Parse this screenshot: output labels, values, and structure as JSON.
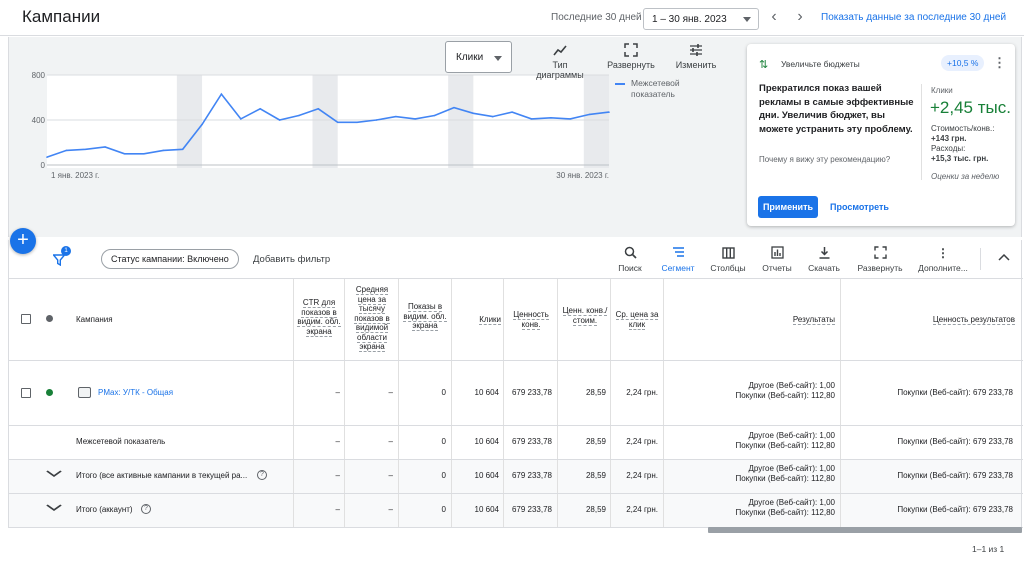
{
  "header": {
    "title": "Кампании",
    "range_label": "Последние 30 дней",
    "date_range": "1 – 30 янв. 2023",
    "prev": "‹",
    "next": "›",
    "show_link": "Показать данные за последние 30 дней"
  },
  "chart_panel": {
    "metric": "Клики",
    "tools": [
      {
        "icon": "trend-icon",
        "label": "Тип диаграммы"
      },
      {
        "icon": "fullscreen-icon",
        "label": "Развернуть"
      },
      {
        "icon": "tune-icon",
        "label": "Изменить"
      }
    ],
    "legend": "Межсетевой показатель"
  },
  "chart_data": {
    "type": "line",
    "x_tick_labels": [
      "1 янв. 2023 г.",
      "30 янв. 2023 г."
    ],
    "y_ticks": [
      0,
      400,
      800
    ],
    "ylim": [
      0,
      800
    ],
    "grid": true,
    "legend_position": "top-right",
    "series": [
      {
        "name": "Межсетевой показатель",
        "color": "#4285f4",
        "values": [
          70,
          130,
          140,
          160,
          100,
          100,
          130,
          140,
          360,
          630,
          410,
          500,
          400,
          440,
          500,
          380,
          380,
          400,
          430,
          410,
          440,
          510,
          460,
          430,
          470,
          410,
          420,
          410,
          450,
          470
        ]
      }
    ]
  },
  "recommendation": {
    "title": "Увеличьте бюджеты",
    "badge": "+10,5 %",
    "text": "Прекратился показ вашей рекламы в самые эффективные дни. Увеличив бюджет, вы можете устранить эту проблему.",
    "why": "Почему я вижу эту рекомендацию?",
    "metric_label": "Клики",
    "metric_value": "+2,45 тыс.",
    "cost_label": "Стоимость/конв.:",
    "cost_value": "+143 грн.",
    "spend_label": "Расходы:",
    "spend_value": "+15,3 тыс. грн.",
    "estimate": "Оценки за неделю",
    "apply": "Применить",
    "view": "Просмотреть"
  },
  "toolbar": {
    "filter_count": "1",
    "status_chip": "Статус кампании: Включено",
    "add_filter": "Добавить фильтр",
    "tools": [
      {
        "icon": "search-icon",
        "label": "Поиск"
      },
      {
        "icon": "segment-icon",
        "label": "Сегмент"
      },
      {
        "icon": "columns-icon",
        "label": "Столбцы"
      },
      {
        "icon": "reports-icon",
        "label": "Отчеты"
      },
      {
        "icon": "download-icon",
        "label": "Скачать"
      },
      {
        "icon": "fullscreen-icon",
        "label": "Развернуть"
      },
      {
        "icon": "more-icon",
        "label": "Дополните..."
      }
    ]
  },
  "table": {
    "headers": {
      "campaign": "Кампания",
      "ctr": "CTR для показов в видим. обл. экрана",
      "cpm": "Средняя цена за тысячу показов в видимой области экрана",
      "impressions": "Показы в видим. обл. экрана",
      "clicks": "Клики",
      "conv_value": "Ценность конв.",
      "value_cost": "Ценн. конв./стоим.",
      "avg_cpc": "Ср. цена за клик",
      "results": "Результаты",
      "results_value": "Ценность результатов"
    },
    "rows": [
      {
        "name": "PMax: У/ТК - Общая",
        "ctr": "–",
        "cpm": "–",
        "impressions": "0",
        "clicks": "10 604",
        "conv_value": "679 233,78",
        "value_cost": "28,59",
        "avg_cpc": "2,24 грн.",
        "results_1": "Другое (Веб-сайт): 1,00",
        "results_2": "Покупки (Веб-сайт): 112,80",
        "results_value": "Покупки (Веб-сайт): 679 233,78"
      },
      {
        "name": "Межсетевой показатель",
        "ctr": "–",
        "cpm": "–",
        "impressions": "0",
        "clicks": "10 604",
        "conv_value": "679 233,78",
        "value_cost": "28,59",
        "avg_cpc": "2,24 грн.",
        "results_1": "Другое (Веб-сайт): 1,00",
        "results_2": "Покупки (Веб-сайт): 112,80",
        "results_value": "Покупки (Веб-сайт): 679 233,78"
      },
      {
        "name": "Итого (все активные кампании в текущей ра...",
        "ctr": "–",
        "cpm": "–",
        "impressions": "0",
        "clicks": "10 604",
        "conv_value": "679 233,78",
        "value_cost": "28,59",
        "avg_cpc": "2,24 грн.",
        "results_1": "Другое (Веб-сайт): 1,00",
        "results_2": "Покупки (Веб-сайт): 112,80",
        "results_value": "Покупки (Веб-сайт): 679 233,78"
      },
      {
        "name": "Итого (аккаунт)",
        "ctr": "–",
        "cpm": "–",
        "impressions": "0",
        "clicks": "10 604",
        "conv_value": "679 233,78",
        "value_cost": "28,59",
        "avg_cpc": "2,24 грн.",
        "results_1": "Другое (Веб-сайт): 1,00",
        "results_2": "Покупки (Веб-сайт): 112,80",
        "results_value": "Покупки (Веб-сайт): 679 233,78"
      }
    ],
    "status_color": "#188038",
    "pagination": "1–1 из 1"
  }
}
